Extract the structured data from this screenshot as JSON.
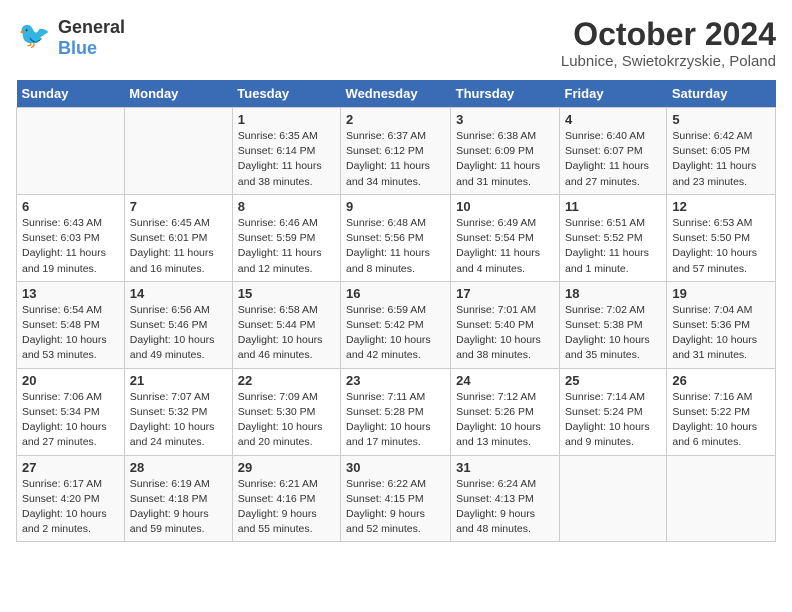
{
  "logo": {
    "general": "General",
    "blue": "Blue"
  },
  "title": "October 2024",
  "subtitle": "Lubnice, Swietokrzyskie, Poland",
  "days_of_week": [
    "Sunday",
    "Monday",
    "Tuesday",
    "Wednesday",
    "Thursday",
    "Friday",
    "Saturday"
  ],
  "weeks": [
    [
      {
        "day": "",
        "info": ""
      },
      {
        "day": "",
        "info": ""
      },
      {
        "day": "1",
        "info": "Sunrise: 6:35 AM\nSunset: 6:14 PM\nDaylight: 11 hours and 38 minutes."
      },
      {
        "day": "2",
        "info": "Sunrise: 6:37 AM\nSunset: 6:12 PM\nDaylight: 11 hours and 34 minutes."
      },
      {
        "day": "3",
        "info": "Sunrise: 6:38 AM\nSunset: 6:09 PM\nDaylight: 11 hours and 31 minutes."
      },
      {
        "day": "4",
        "info": "Sunrise: 6:40 AM\nSunset: 6:07 PM\nDaylight: 11 hours and 27 minutes."
      },
      {
        "day": "5",
        "info": "Sunrise: 6:42 AM\nSunset: 6:05 PM\nDaylight: 11 hours and 23 minutes."
      }
    ],
    [
      {
        "day": "6",
        "info": "Sunrise: 6:43 AM\nSunset: 6:03 PM\nDaylight: 11 hours and 19 minutes."
      },
      {
        "day": "7",
        "info": "Sunrise: 6:45 AM\nSunset: 6:01 PM\nDaylight: 11 hours and 16 minutes."
      },
      {
        "day": "8",
        "info": "Sunrise: 6:46 AM\nSunset: 5:59 PM\nDaylight: 11 hours and 12 minutes."
      },
      {
        "day": "9",
        "info": "Sunrise: 6:48 AM\nSunset: 5:56 PM\nDaylight: 11 hours and 8 minutes."
      },
      {
        "day": "10",
        "info": "Sunrise: 6:49 AM\nSunset: 5:54 PM\nDaylight: 11 hours and 4 minutes."
      },
      {
        "day": "11",
        "info": "Sunrise: 6:51 AM\nSunset: 5:52 PM\nDaylight: 11 hours and 1 minute."
      },
      {
        "day": "12",
        "info": "Sunrise: 6:53 AM\nSunset: 5:50 PM\nDaylight: 10 hours and 57 minutes."
      }
    ],
    [
      {
        "day": "13",
        "info": "Sunrise: 6:54 AM\nSunset: 5:48 PM\nDaylight: 10 hours and 53 minutes."
      },
      {
        "day": "14",
        "info": "Sunrise: 6:56 AM\nSunset: 5:46 PM\nDaylight: 10 hours and 49 minutes."
      },
      {
        "day": "15",
        "info": "Sunrise: 6:58 AM\nSunset: 5:44 PM\nDaylight: 10 hours and 46 minutes."
      },
      {
        "day": "16",
        "info": "Sunrise: 6:59 AM\nSunset: 5:42 PM\nDaylight: 10 hours and 42 minutes."
      },
      {
        "day": "17",
        "info": "Sunrise: 7:01 AM\nSunset: 5:40 PM\nDaylight: 10 hours and 38 minutes."
      },
      {
        "day": "18",
        "info": "Sunrise: 7:02 AM\nSunset: 5:38 PM\nDaylight: 10 hours and 35 minutes."
      },
      {
        "day": "19",
        "info": "Sunrise: 7:04 AM\nSunset: 5:36 PM\nDaylight: 10 hours and 31 minutes."
      }
    ],
    [
      {
        "day": "20",
        "info": "Sunrise: 7:06 AM\nSunset: 5:34 PM\nDaylight: 10 hours and 27 minutes."
      },
      {
        "day": "21",
        "info": "Sunrise: 7:07 AM\nSunset: 5:32 PM\nDaylight: 10 hours and 24 minutes."
      },
      {
        "day": "22",
        "info": "Sunrise: 7:09 AM\nSunset: 5:30 PM\nDaylight: 10 hours and 20 minutes."
      },
      {
        "day": "23",
        "info": "Sunrise: 7:11 AM\nSunset: 5:28 PM\nDaylight: 10 hours and 17 minutes."
      },
      {
        "day": "24",
        "info": "Sunrise: 7:12 AM\nSunset: 5:26 PM\nDaylight: 10 hours and 13 minutes."
      },
      {
        "day": "25",
        "info": "Sunrise: 7:14 AM\nSunset: 5:24 PM\nDaylight: 10 hours and 9 minutes."
      },
      {
        "day": "26",
        "info": "Sunrise: 7:16 AM\nSunset: 5:22 PM\nDaylight: 10 hours and 6 minutes."
      }
    ],
    [
      {
        "day": "27",
        "info": "Sunrise: 6:17 AM\nSunset: 4:20 PM\nDaylight: 10 hours and 2 minutes."
      },
      {
        "day": "28",
        "info": "Sunrise: 6:19 AM\nSunset: 4:18 PM\nDaylight: 9 hours and 59 minutes."
      },
      {
        "day": "29",
        "info": "Sunrise: 6:21 AM\nSunset: 4:16 PM\nDaylight: 9 hours and 55 minutes."
      },
      {
        "day": "30",
        "info": "Sunrise: 6:22 AM\nSunset: 4:15 PM\nDaylight: 9 hours and 52 minutes."
      },
      {
        "day": "31",
        "info": "Sunrise: 6:24 AM\nSunset: 4:13 PM\nDaylight: 9 hours and 48 minutes."
      },
      {
        "day": "",
        "info": ""
      },
      {
        "day": "",
        "info": ""
      }
    ]
  ]
}
